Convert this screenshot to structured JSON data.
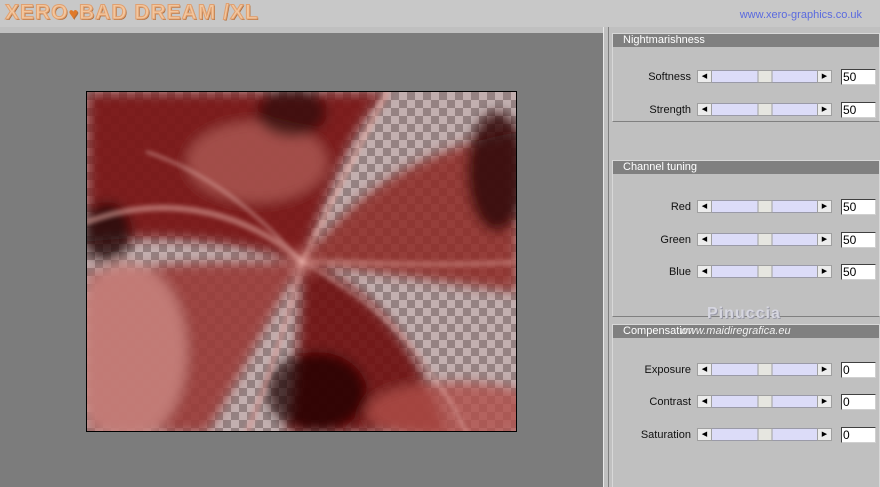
{
  "header": {
    "logo_left": "XERO",
    "logo_heart": "♥",
    "logo_right": "BAD DREAM /XL",
    "website": "www.xero-graphics.co.uk"
  },
  "groups": [
    {
      "title": "Nightmarishness",
      "controls": [
        {
          "label": "Softness",
          "value": "50",
          "level": 0.5
        },
        {
          "label": "Strength",
          "value": "50",
          "level": 0.5
        }
      ]
    },
    {
      "title": "Channel tuning",
      "controls": [
        {
          "label": "Red",
          "value": "50",
          "level": 0.5
        },
        {
          "label": "Green",
          "value": "50",
          "level": 0.5
        },
        {
          "label": "Blue",
          "value": "50",
          "level": 0.5
        }
      ]
    },
    {
      "title": "Compensation",
      "controls": [
        {
          "label": "Exposure",
          "value": "0",
          "level": 0.5
        },
        {
          "label": "Contrast",
          "value": "0",
          "level": 0.5
        },
        {
          "label": "Saturation",
          "value": "0",
          "level": 0.5
        }
      ]
    }
  ],
  "watermark": {
    "name": "Pinuccia",
    "url": "www.maidiregrafica.eu"
  },
  "colors": {
    "panel_bg": "#c0c0c0",
    "group_header": "#808080",
    "slider_track": "#dcdcf8",
    "preview_bg": "#7c7c7c",
    "link": "#5a6adf"
  }
}
